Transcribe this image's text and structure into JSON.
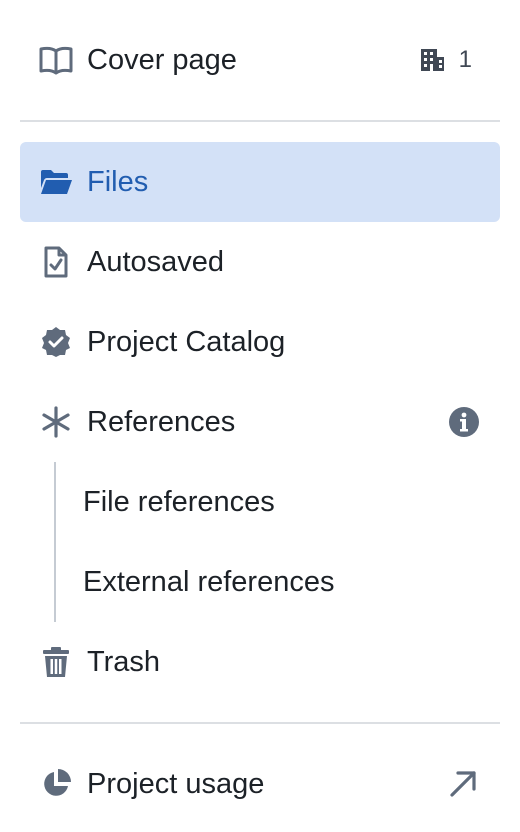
{
  "nav": {
    "cover": {
      "label": "Cover page",
      "count": "1",
      "icon": "book-open-icon",
      "count_icon": "building-icon"
    },
    "files": {
      "label": "Files",
      "icon": "folder-open-icon",
      "active": true
    },
    "autosaved": {
      "label": "Autosaved",
      "icon": "document-check-icon"
    },
    "catalog": {
      "label": "Project Catalog",
      "icon": "verified-badge-icon"
    },
    "references": {
      "label": "References",
      "icon": "asterisk-icon",
      "info_icon": "info-icon",
      "children": [
        {
          "label": "File references"
        },
        {
          "label": "External references"
        }
      ]
    },
    "trash": {
      "label": "Trash",
      "icon": "trash-icon"
    },
    "usage": {
      "label": "Project usage",
      "icon": "pie-chart-icon",
      "action_icon": "arrow-top-right-icon"
    }
  },
  "colors": {
    "active_bg": "#d3e1f7",
    "active_text": "#215db0",
    "icon_gray": "#5f6b7c",
    "text": "#1c2127",
    "divider": "#dcdfe3"
  }
}
